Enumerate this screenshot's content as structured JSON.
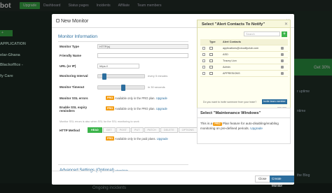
{
  "app": {
    "logo": "bot",
    "upgrade": "Upgrade"
  },
  "topnav": [
    "Dashboard",
    "Status pages",
    "Incidents",
    "Affiliate",
    "Team members"
  ],
  "background": {
    "new_btn": "+",
    "left_items": [
      "APPLICATION",
      "elar-Ghana",
      "Blackoffice -",
      "fy Care"
    ],
    "right_texts": [
      "r uptime",
      "ntime",
      "Get 30%",
      "the Blog"
    ],
    "bottom": "Ongoing incidents"
  },
  "modal": {
    "title": "New Monitor",
    "info_title": "Monitor Information",
    "fields": {
      "type_label": "Monitor Type",
      "type_value": "HTTP(s)",
      "name_label": "Friendly Name",
      "name_value": "",
      "url_label": "URL (or IP)",
      "url_value": "https://",
      "interval_label": "Monitoring Interval",
      "interval_hint": "every 5 minutes",
      "interval_level": 0.1,
      "timeout_label": "Monitor Timeout",
      "timeout_hint": "in 30 seconds",
      "timeout_level": 0.55,
      "ssl_label": "Monitor SSL errors",
      "expiry_label": "Enable SSL expiry reminders",
      "pro_badge": "PRO",
      "pro_text": "Available only in the PRO plan.",
      "pro_link": "Upgrade",
      "ssl_note": "Monitor SSL errors is also when SSL for the SSL monitoring to work",
      "http_method_label": "HTTP Method",
      "methods": [
        "HEAD",
        "GET",
        "POST",
        "PUT",
        "PATCH",
        "DELETE",
        "OPTIONS"
      ],
      "paid_text": "Available only in the paid plans.",
      "paid_link": "Upgrade"
    },
    "advanced": "Advanced Settings (Optional)",
    "advanced_toggle": "show/hide",
    "alert": {
      "title": "Select \"Alert Contacts To Notify\"",
      "search_placeholder": "Search",
      "add": "+",
      "headers": [
        "Type",
        "Alert Contacts"
      ],
      "contacts": [
        "applications@cloudfyclub.com",
        "ASD",
        "Tracey Lion",
        "Admin",
        "APPRESIONS"
      ],
      "invite_text": "Do you want to invite someone from your team?",
      "invite_btn": "Invite team member",
      "pager": [
        "‹",
        "›"
      ]
    },
    "maintenance": {
      "title": "Select \"Maintenance Windows\"",
      "text_before": "This is a",
      "badge": "PRO",
      "text_after": "Plan feature for auto-disabling/enabling monitoring on pre-defined periods.",
      "link": "Upgrade"
    },
    "footer": {
      "close": "Close",
      "create": "Create Monitor"
    }
  }
}
